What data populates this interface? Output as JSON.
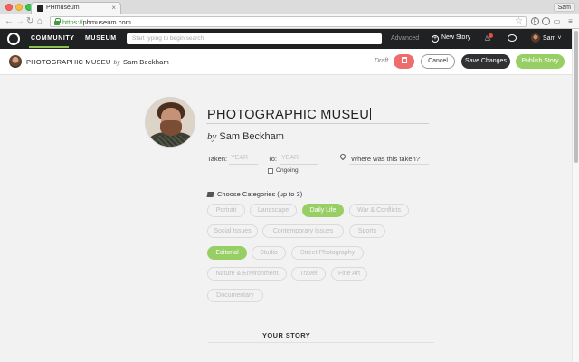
{
  "browser": {
    "tab_title": "PHmuseum",
    "tab_close": "×",
    "user_label": "Sam",
    "url_scheme": "https://",
    "url_host": "phmuseum.com",
    "nav_icons": [
      "back-icon",
      "forward-icon",
      "reload-icon",
      "home-icon"
    ],
    "extensions": [
      "pinterest-icon",
      "info-icon",
      "cast-icon",
      "menu-icon"
    ]
  },
  "site_nav": {
    "community": "COMMUNITY",
    "museum": "MUSEUM",
    "search_placeholder": "Start typing to begin search",
    "advanced": "Advanced",
    "new_story": "New Story",
    "user": "Sam",
    "accent": "#8cc152"
  },
  "editor": {
    "title": "PHOTOGRAPHIC MUSEU",
    "by": "by",
    "author": "Sam Beckham",
    "draft": "Draft",
    "cancel": "Cancel",
    "save": "Save Changes",
    "publish": "Publish Story",
    "colors": {
      "delete": "#ef6c6c",
      "save": "#2f3133",
      "publish": "#97cf65"
    }
  },
  "story": {
    "title": "PHOTOGRAPHIC MUSEU",
    "by": "by",
    "author": "Sam Beckham",
    "taken_label": "Taken:",
    "taken_placeholder": "YEAR",
    "to_label": "To:",
    "to_placeholder": "YEAR",
    "ongoing_label": "Ongoing",
    "ongoing_checked": false,
    "where_placeholder": "Where was this taken?"
  },
  "categories": {
    "heading": "Choose Categories (up to 3)",
    "items": [
      {
        "label": "Portrait",
        "selected": false
      },
      {
        "label": "Landscape",
        "selected": false
      },
      {
        "label": "Daily Life",
        "selected": true
      },
      {
        "label": "War & Conflicts",
        "selected": false
      },
      {
        "label": "Social Issues",
        "selected": false
      },
      {
        "label": "Contemporary Issues",
        "selected": false
      },
      {
        "label": "Sports",
        "selected": false
      },
      {
        "label": "Editorial",
        "selected": true
      },
      {
        "label": "Studio",
        "selected": false
      },
      {
        "label": "Street Photography",
        "selected": false
      },
      {
        "label": "Nature & Environment",
        "selected": false
      },
      {
        "label": "Travel",
        "selected": false
      },
      {
        "label": "Fine Art",
        "selected": false
      },
      {
        "label": "Documentary",
        "selected": false
      }
    ]
  },
  "your_story": "YOUR STORY"
}
